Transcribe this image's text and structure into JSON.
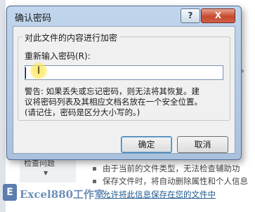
{
  "dialog": {
    "title": "确认密码",
    "help_label": "?",
    "close_label": "X",
    "group_title": "对此文件的内容进行加密",
    "prompt_label": "重新输入密码(R):",
    "password_value": "",
    "warning_lines": [
      "警告: 如果丢失或忘记密码，则无法将其恢复。建",
      "议将密码列表及其相应文档名放在一个安全位置。",
      "(请记住，密码是区分大小写的。)"
    ],
    "ok_label": "确定",
    "cancel_label": "取消"
  },
  "background": {
    "right_fragment": "型。",
    "bottom_left_label": "检查问题",
    "lines": [
      "由于当前的文件类型，无法检查辅助功",
      "保存文件时，将自动删除属性和个人信息",
      "允许将此信息保存在您的文件中"
    ],
    "watermark": "Excel880工作室",
    "watermark_badge": "E"
  },
  "colors": {
    "title_bar": "#b7cde6",
    "close_button": "#c6492c",
    "link": "#215a8e",
    "cursor_highlight": "#ffe450"
  }
}
